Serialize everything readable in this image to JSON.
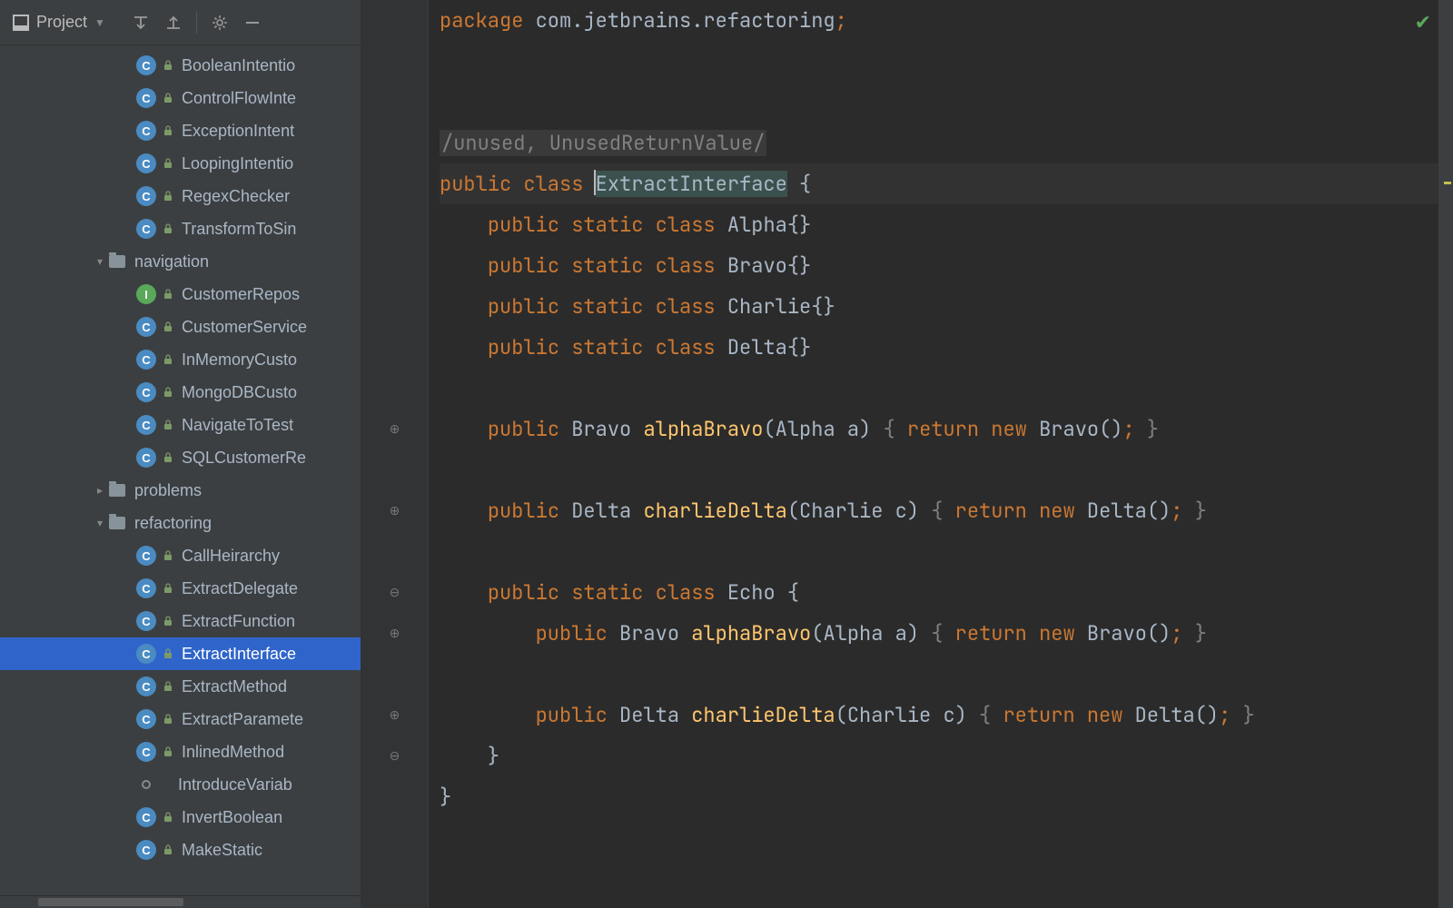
{
  "sidebar": {
    "title": "Project",
    "items": [
      {
        "depth": 2,
        "icon": "class",
        "label": "BooleanIntentio"
      },
      {
        "depth": 2,
        "icon": "class",
        "label": "ControlFlowInte"
      },
      {
        "depth": 2,
        "icon": "class",
        "label": "ExceptionIntent"
      },
      {
        "depth": 2,
        "icon": "class",
        "label": "LoopingIntentio"
      },
      {
        "depth": 2,
        "icon": "class",
        "label": "RegexChecker"
      },
      {
        "depth": 2,
        "icon": "class",
        "label": "TransformToSin"
      },
      {
        "depth": 1,
        "icon": "folder",
        "chevron": "down",
        "label": "navigation"
      },
      {
        "depth": 2,
        "icon": "class-green",
        "label": "CustomerRepos"
      },
      {
        "depth": 2,
        "icon": "class",
        "label": "CustomerService"
      },
      {
        "depth": 2,
        "icon": "class",
        "label": "InMemoryCusto"
      },
      {
        "depth": 2,
        "icon": "class",
        "label": "MongoDBCusto"
      },
      {
        "depth": 2,
        "icon": "class",
        "label": "NavigateToTest"
      },
      {
        "depth": 2,
        "icon": "class",
        "label": "SQLCustomerRe"
      },
      {
        "depth": 1,
        "icon": "folder",
        "chevron": "right",
        "label": "problems"
      },
      {
        "depth": 1,
        "icon": "folder",
        "chevron": "down",
        "label": "refactoring"
      },
      {
        "depth": 2,
        "icon": "class",
        "label": "CallHeirarchy"
      },
      {
        "depth": 2,
        "icon": "class",
        "label": "ExtractDelegate"
      },
      {
        "depth": 2,
        "icon": "class",
        "label": "ExtractFunction"
      },
      {
        "depth": 2,
        "icon": "class",
        "label": "ExtractInterface",
        "selected": true
      },
      {
        "depth": 2,
        "icon": "class",
        "label": "ExtractMethod"
      },
      {
        "depth": 2,
        "icon": "class",
        "label": "ExtractParamete"
      },
      {
        "depth": 2,
        "icon": "class",
        "label": "InlinedMethod"
      },
      {
        "depth": 2,
        "icon": "ring",
        "label": "IntroduceVariab"
      },
      {
        "depth": 2,
        "icon": "class",
        "label": "InvertBoolean"
      },
      {
        "depth": 2,
        "icon": "class",
        "label": "MakeStatic"
      }
    ]
  },
  "code": {
    "package_kw": "package",
    "package_name": " com.jetbrains.refactoring",
    "semicolon": ";",
    "comment": "/unused, UnusedReturnValue/",
    "public": "public",
    "class": "class",
    "static": "static",
    "return": "return",
    "new": "new",
    "cls_main": "ExtractInterface",
    "cls_alpha": "Alpha",
    "cls_bravo": "Bravo",
    "cls_charlie": "Charlie",
    "cls_delta": "Delta",
    "cls_echo": "Echo",
    "m_alphaBravo": "alphaBravo",
    "m_charlieDelta": "charlieDelta",
    "p_a": "(Alpha a)",
    "p_c": "(Charlie c)",
    "empty": "{}",
    "open": " {",
    "close": "}",
    "call_bravo": " Bravo()",
    "call_delta": " Delta()",
    "semi": "; "
  }
}
